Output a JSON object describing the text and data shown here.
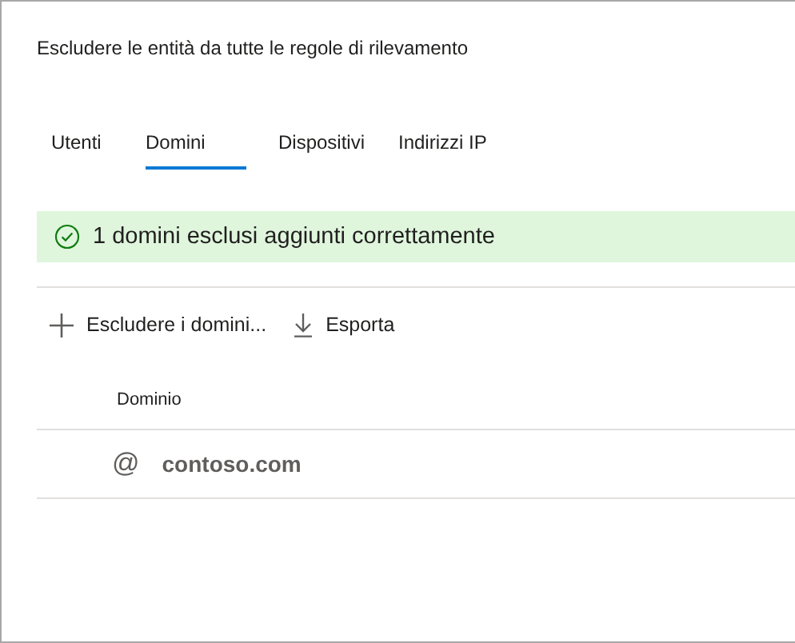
{
  "title": "Escludere le entità da tutte le regole di rilevamento",
  "tabs": [
    {
      "label": "Utenti",
      "selected": false
    },
    {
      "label": "Domini",
      "selected": true
    },
    {
      "label": "Dispositivi",
      "selected": false
    },
    {
      "label": "Indirizzi IP",
      "selected": false
    }
  ],
  "banner": {
    "kind": "success",
    "message": "1 domini esclusi aggiunti correttamente"
  },
  "toolbar": [
    {
      "kind": "add",
      "label": "Escludere i domini..."
    },
    {
      "kind": "export",
      "label": "Esporta"
    }
  ],
  "table": {
    "columns": [
      "Dominio"
    ],
    "rows": [
      {
        "symbol": "@",
        "domain": "contoso.com"
      }
    ]
  }
}
